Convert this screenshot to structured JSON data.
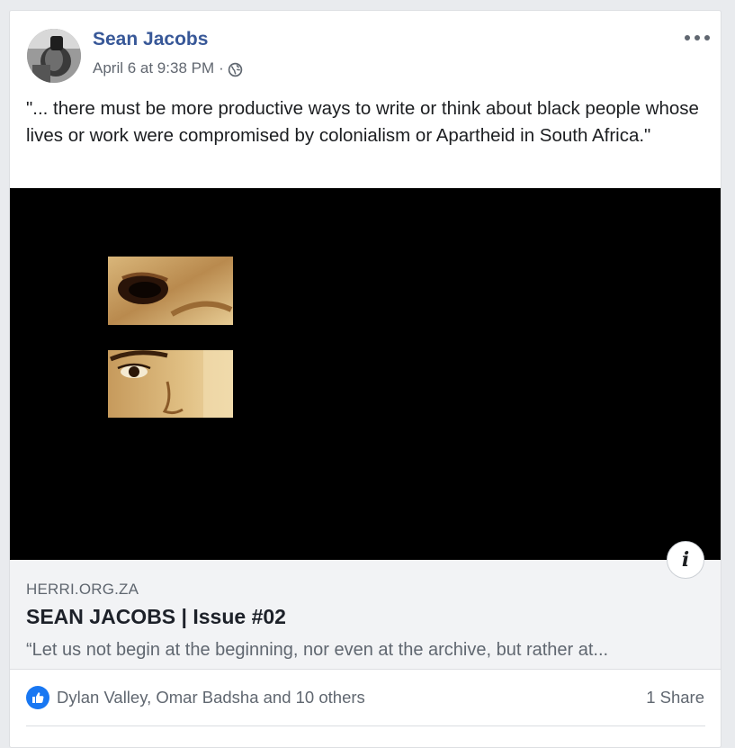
{
  "post": {
    "author": "Sean Jacobs",
    "date": "April 6 at 9:38 PM",
    "separator": "·",
    "privacy_icon": "globe-icon",
    "more_icon": "more-options-icon",
    "text": "\"... there must be more productive ways to write or think about black people whose lives or work were compromised by colonialism or Apartheid in South Africa.\""
  },
  "link_preview": {
    "domain": "HERRI.ORG.ZA",
    "title": "SEAN JACOBS | Issue #02",
    "description": "“Let us not begin at the beginning, nor even at the archive, but rather at...",
    "info_label": "i"
  },
  "footer": {
    "reaction_icon": "like-icon",
    "reactions_text": "Dylan Valley, Omar Badsha and 10 others",
    "shares_text": "1 Share"
  },
  "colors": {
    "author_link": "#385898",
    "like_blue": "#1877f2",
    "link_box_bg": "#f2f3f5",
    "secondary_text": "#606770"
  }
}
